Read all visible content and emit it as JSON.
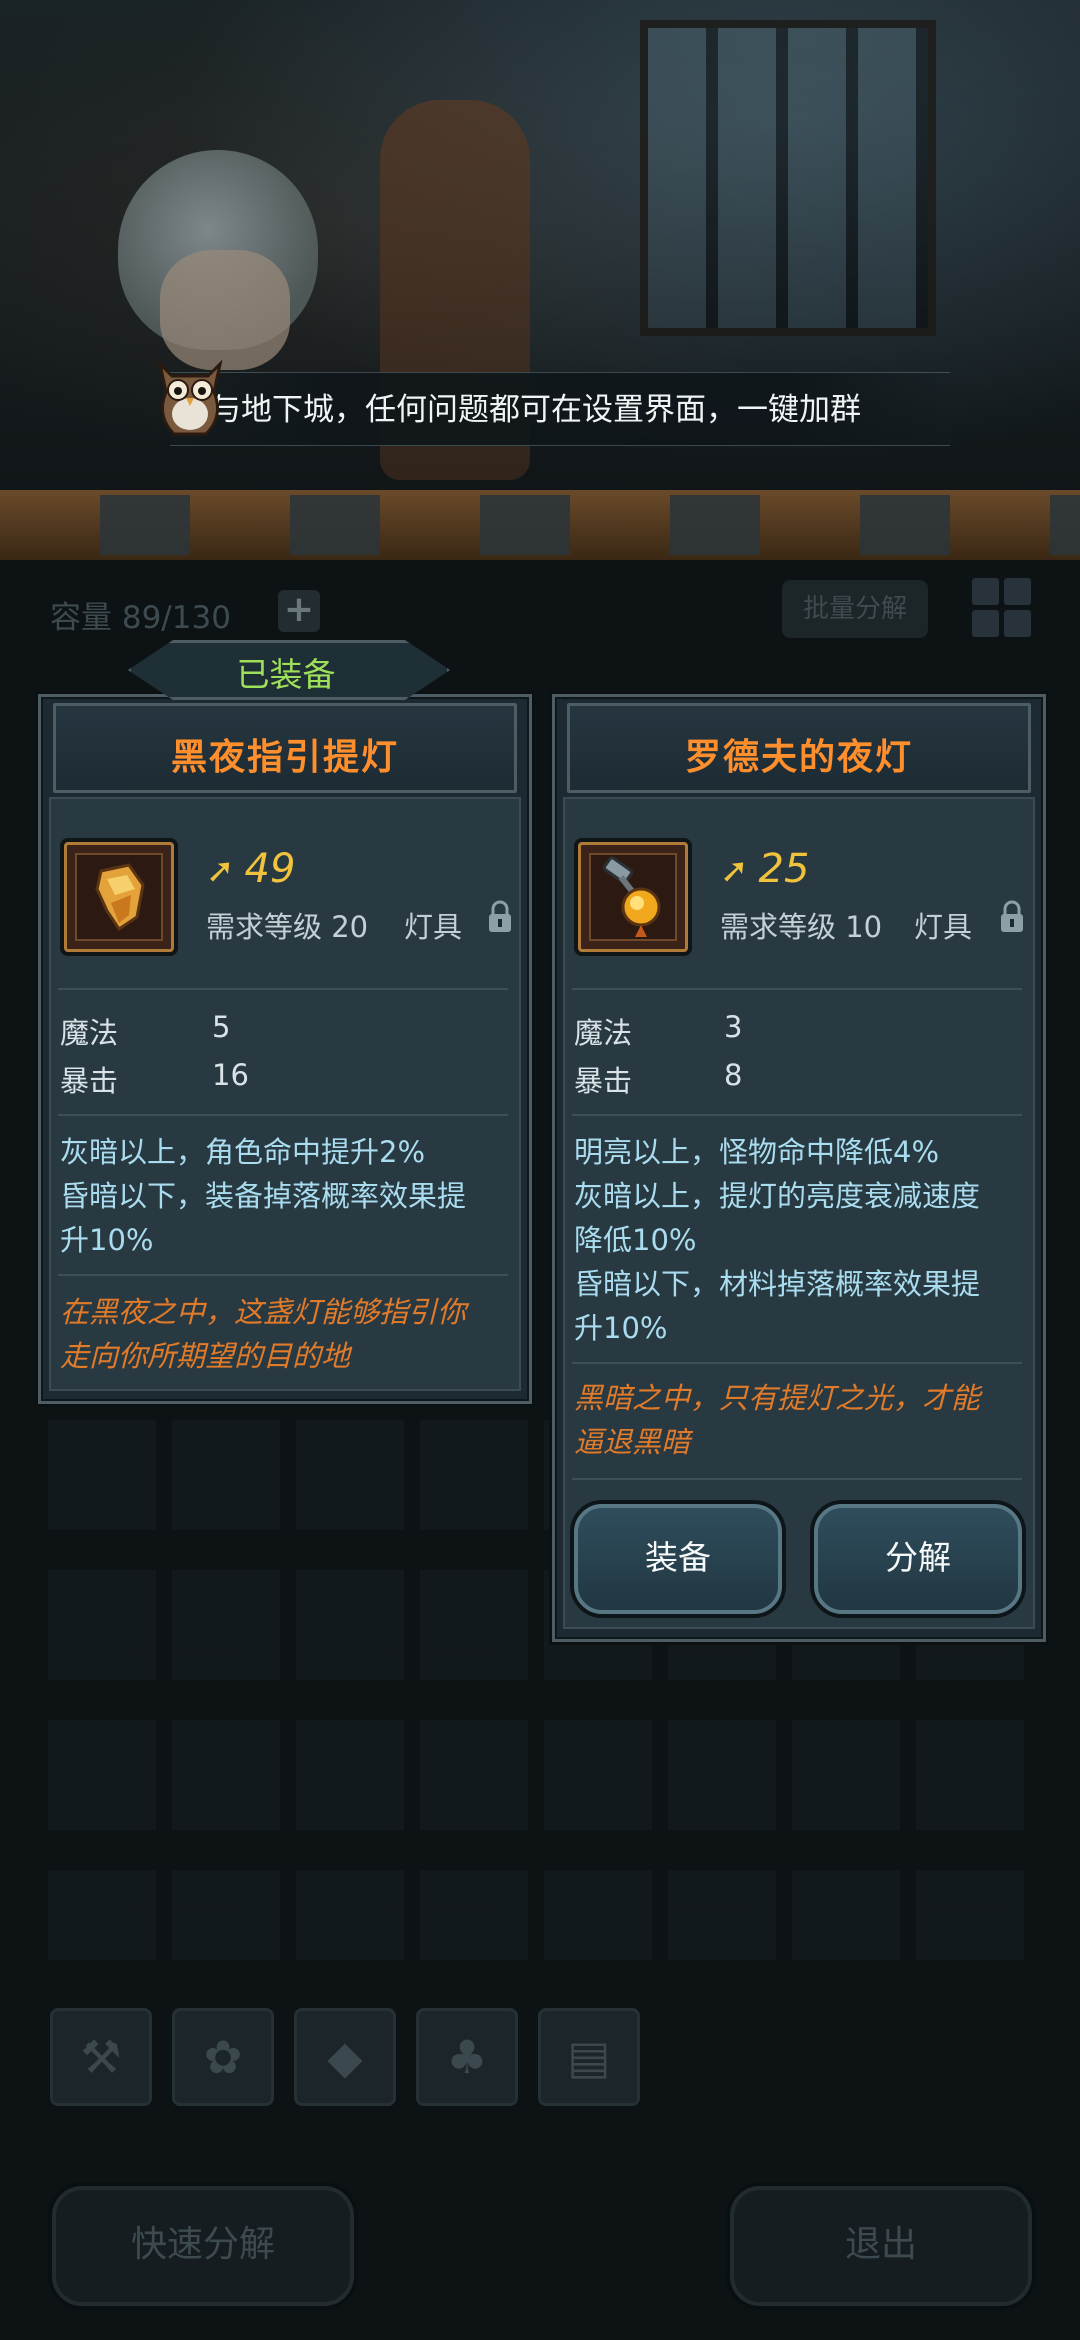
{
  "banner": {
    "text": "与地下城，任何问题都可在设置界面，一键加群"
  },
  "inventory": {
    "capacity": "容量 89/130",
    "plus": "+",
    "batch_label": "批量分解"
  },
  "equipped_item": {
    "tag": "已装备",
    "name": "黑夜指引提灯",
    "power": "49",
    "requirement": "需求等级 20",
    "slot": "灯具",
    "stats": [
      {
        "label": "魔法",
        "value": "5"
      },
      {
        "label": "暴击",
        "value": "16"
      }
    ],
    "effects": [
      "灰暗以上，角色命中提升2%",
      "昏暗以下，装备掉落概率效果提",
      "升10%"
    ],
    "flavor": [
      "在黑夜之中，这盏灯能够指引你",
      "走向你所期望的目的地"
    ]
  },
  "new_item": {
    "name": "罗德夫的夜灯",
    "power": "25",
    "requirement": "需求等级 10",
    "slot": "灯具",
    "stats": [
      {
        "label": "魔法",
        "value": "3"
      },
      {
        "label": "暴击",
        "value": "8"
      }
    ],
    "effects": [
      "明亮以上，怪物命中降低4%",
      "灰暗以上，提灯的亮度衰减速度",
      "降低10%",
      "昏暗以下，材料掉落概率效果提",
      "升10%"
    ],
    "flavor": [
      "黑暗之中，只有提灯之光，才能",
      "逼退黑暗"
    ],
    "equip_label": "装备",
    "decompose_label": "分解"
  },
  "filters": [
    "weapon-icon",
    "paw-icon",
    "gem-icon",
    "leaf-icon",
    "chest-icon"
  ],
  "bottom": {
    "quick_decompose": "快速分解",
    "exit": "退出"
  }
}
